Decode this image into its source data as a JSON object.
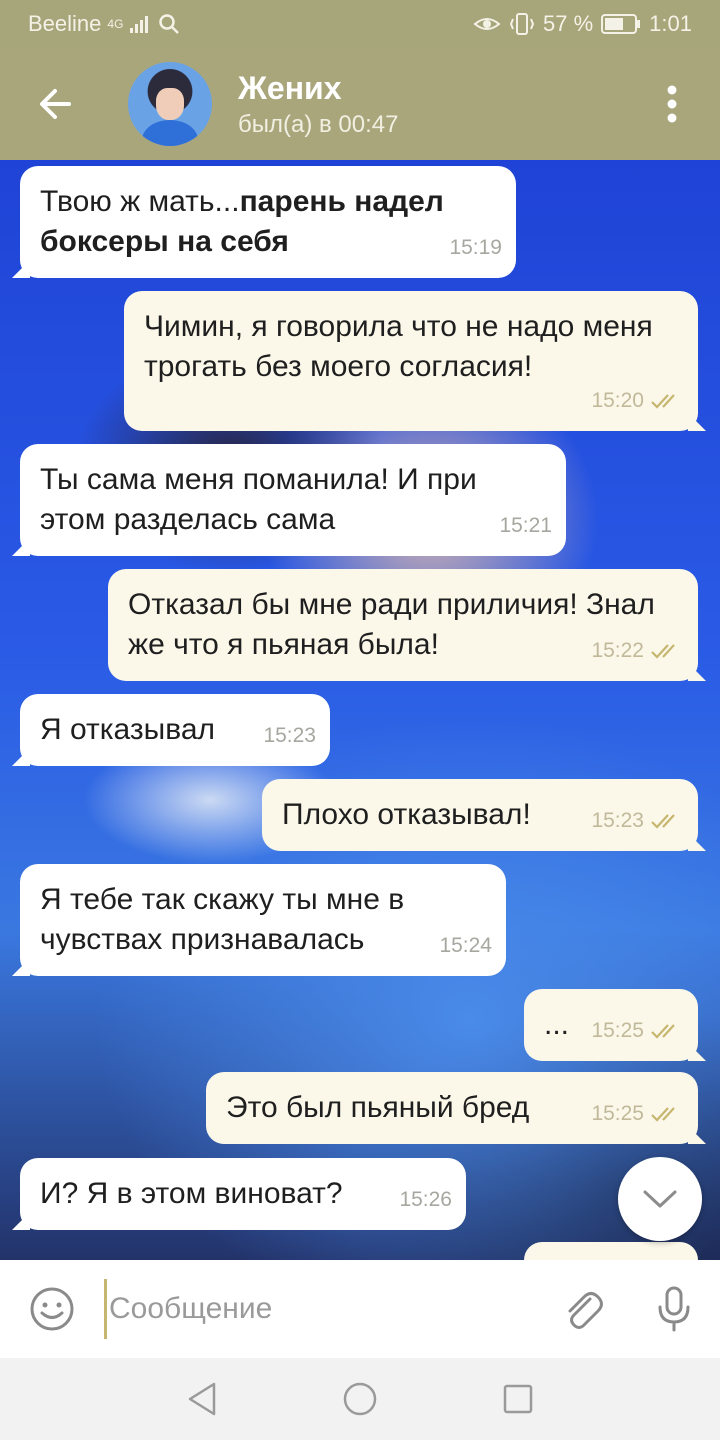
{
  "status_bar": {
    "carrier": "Beeline",
    "network": "4G",
    "battery": "57 %",
    "time": "1:01"
  },
  "header": {
    "title": "Жених",
    "status": "был(а) в 00:47",
    "back_icon": "arrow-left-icon",
    "menu_icon": "more-vertical-icon"
  },
  "messages": [
    {
      "direction": "in",
      "text": "Твою ж мать...",
      "bold": "парень надел боксеры на себя",
      "time": "15:19"
    },
    {
      "direction": "out",
      "text": "Чимин, я говорила что не надо меня трогать без моего согласия!",
      "time": "15:20"
    },
    {
      "direction": "in",
      "text": "Ты сама меня поманила! И при этом разделась сама",
      "time": "15:21"
    },
    {
      "direction": "out",
      "text": "Отказал бы мне ради приличия! Знал же что я пьяная была!",
      "time": "15:22"
    },
    {
      "direction": "in",
      "text": "Я отказывал",
      "time": "15:23"
    },
    {
      "direction": "out",
      "text": "Плохо отказывал!",
      "time": "15:23"
    },
    {
      "direction": "in",
      "text": "Я тебе так скажу ты мне в чувствах признавалась",
      "time": "15:24"
    },
    {
      "direction": "out",
      "text": "...",
      "time": "15:25"
    },
    {
      "direction": "out",
      "text": "Это был пьяный бред",
      "time": "15:25"
    },
    {
      "direction": "in",
      "text": "И? Я в этом виноват?",
      "time": "15:26"
    }
  ],
  "input": {
    "placeholder": "Сообщение",
    "value": ""
  },
  "colors": {
    "header_bg": "#a9a67b",
    "incoming_bubble": "#ffffff",
    "outgoing_bubble": "#fbf8ea",
    "read_check": "#c6b66f"
  }
}
